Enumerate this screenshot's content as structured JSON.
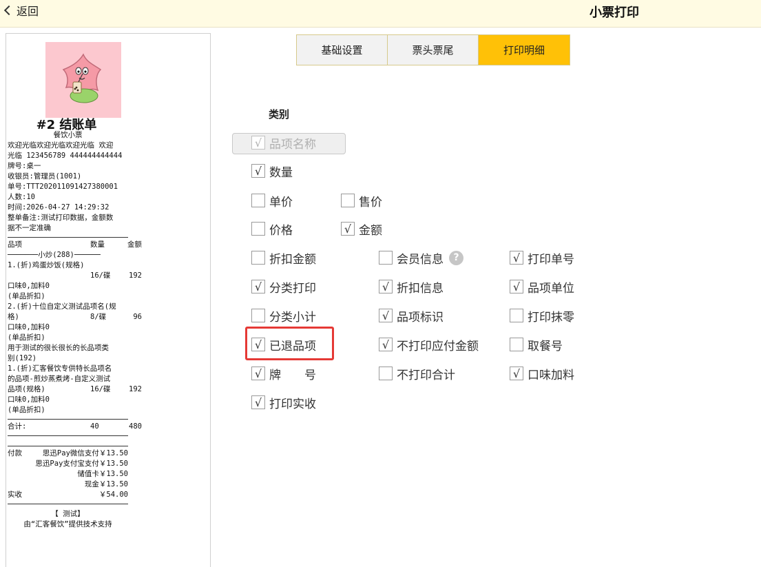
{
  "header": {
    "back_label": "返回",
    "title": "小票打印"
  },
  "tabs": [
    {
      "label": "基础设置",
      "active": false
    },
    {
      "label": "票头票尾",
      "active": false
    },
    {
      "label": "打印明细",
      "active": true
    }
  ],
  "category_label": "类别",
  "options": {
    "item_name": {
      "label": "品项名称",
      "checked": true,
      "disabled": true
    },
    "quantity": {
      "label": "数量",
      "checked": true
    },
    "unit_price": {
      "label": "单价",
      "checked": false
    },
    "sale_price": {
      "label": "售价",
      "checked": false
    },
    "price": {
      "label": "价格",
      "checked": false
    },
    "amount": {
      "label": "金额",
      "checked": true
    },
    "discount_amount": {
      "label": "折扣金额",
      "checked": false
    },
    "member_info": {
      "label": "会员信息",
      "checked": false
    },
    "print_order_no": {
      "label": "打印单号",
      "checked": true
    },
    "category_print": {
      "label": "分类打印",
      "checked": true
    },
    "discount_info": {
      "label": "折扣信息",
      "checked": true
    },
    "item_unit": {
      "label": "品项单位",
      "checked": true
    },
    "category_subtotal": {
      "label": "分类小计",
      "checked": false
    },
    "item_mark": {
      "label": "品项标识",
      "checked": true
    },
    "print_rounding": {
      "label": "打印抹零",
      "checked": false
    },
    "returned_items": {
      "label": "已退品项",
      "checked": true
    },
    "no_print_payable": {
      "label": "不打印应付金额",
      "checked": true
    },
    "pickup_no": {
      "label": "取餐号",
      "checked": false
    },
    "table_no": {
      "label": "牌　　号",
      "checked": true
    },
    "no_print_total": {
      "label": "不打印合计",
      "checked": false
    },
    "flavor_addon": {
      "label": "口味加料",
      "checked": true
    },
    "print_received": {
      "label": "打印实收",
      "checked": true
    }
  },
  "help_glyph": "?",
  "check_glyph": "√",
  "receipt": {
    "title": "#2 结账单",
    "subtitle": "餐饮小票",
    "welcome_1": "欢迎光临欢迎光临欢迎光临 欢迎",
    "welcome_2": "光临  123456789 444444444444",
    "table": "牌号:桌一",
    "cashier": "收银员:管理员(1001)",
    "order_no": "单号:TTT202011091427380001",
    "people": "人数:10",
    "time": "时间:2026-04-27 14:29:32",
    "remark_1": "整单备注:测试打印数据，金额数",
    "remark_2": "据不一定准确",
    "col_item": "品项",
    "col_qty": "数量",
    "col_amount": "金额",
    "category_1": "───────小炒(288)──────",
    "item1_name": "1.(折)鸡蛋炒饭(规格)",
    "item1_qty": "16/碟",
    "item1_amount": "192",
    "item1_flavor": "口味0,加料0",
    "item1_discount": "(单品折扣)",
    "item2_name_1": "2.(折)十位自定义测试品项名(规",
    "item2_name_2": "格)",
    "item2_qty": "8/碟",
    "item2_amount": "96",
    "item2_flavor": "口味0,加料0",
    "item2_discount": "(单品折扣)",
    "category_2_1": "用于测试的很长很长的长品项类",
    "category_2_2": "别(192)",
    "item3_name_1": "1.(折)汇客餐饮专供特长品项名",
    "item3_name_2": "的品项-煎炒蒸煮烤-自定义测试",
    "item3_name_3": "品项(规格)",
    "item3_qty": "16/碟",
    "item3_amount": "192",
    "item3_flavor": "口味0,加料0",
    "item3_discount": "(单品折扣)",
    "total_label": "合计:",
    "total_qty": "40",
    "total_amount": "480",
    "pay_label": "付款",
    "pay_1": "思迅Pay微信支付￥13.50",
    "pay_2": "思迅Pay支付宝支付￥13.50",
    "pay_3": "储值卡￥13.50",
    "pay_4": "现金￥13.50",
    "received_label": "实收",
    "received_value": "￥54.00",
    "footer_1": "【 测试】",
    "footer_2": "由“汇客餐饮”提供技术支持"
  }
}
